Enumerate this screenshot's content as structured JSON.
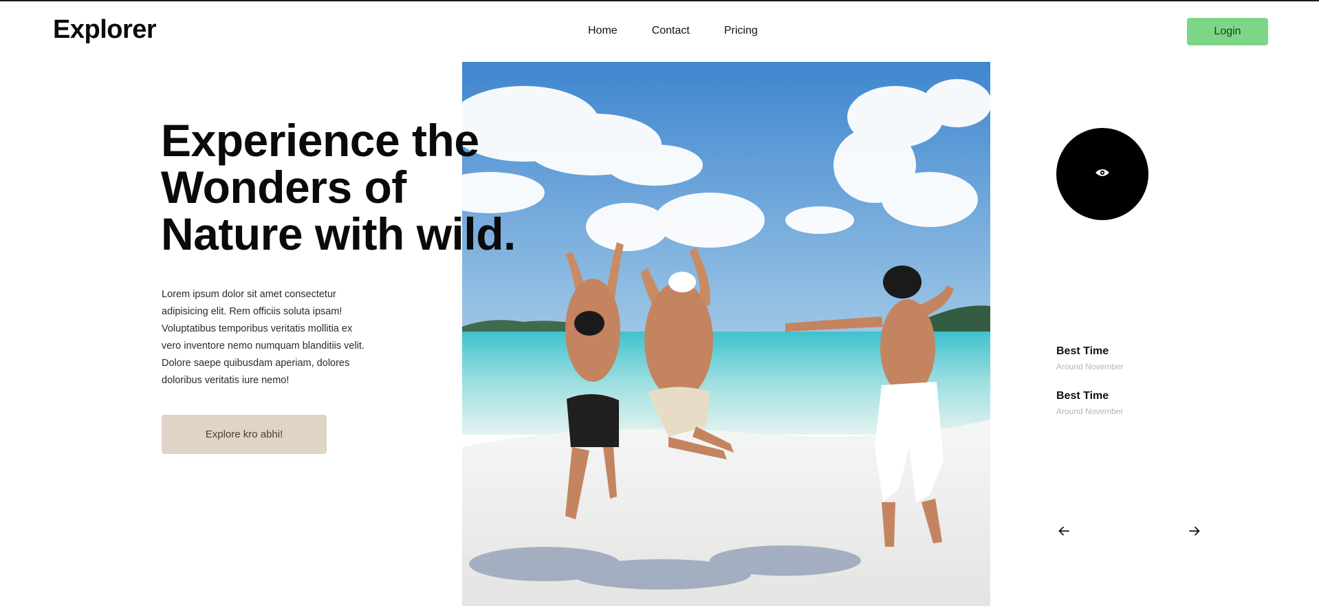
{
  "header": {
    "logo": "Explorer",
    "nav": [
      {
        "label": "Home"
      },
      {
        "label": "Contact"
      },
      {
        "label": "Pricing"
      }
    ],
    "login_label": "Login"
  },
  "hero": {
    "title_lines": [
      "Experience the",
      "Wonders of",
      "Nature with wild."
    ],
    "description": "Lorem ipsum dolor sit amet consectetur adipisicing elit. Rem officiis soluta ipsam! Voluptatibus temporibus veritatis mollitia ex vero inventore nemo numquam blanditiis velit. Dolore saepe quibusdam aperiam, dolores doloribus veritatis iure nemo!",
    "cta_label": "Explore kro abhi!",
    "photo_icon": "beach-jump-photo"
  },
  "side": {
    "view_icon": "eye-icon",
    "info": [
      {
        "title": "Best Time",
        "subtitle": "Around November"
      },
      {
        "title": "Best Time",
        "subtitle": "Around November"
      }
    ],
    "prev_icon": "arrow-left-icon",
    "next_icon": "arrow-right-icon"
  },
  "colors": {
    "login_bg": "#7dd686",
    "cta_bg": "#e0d4c6",
    "circle_bg": "#000000"
  }
}
